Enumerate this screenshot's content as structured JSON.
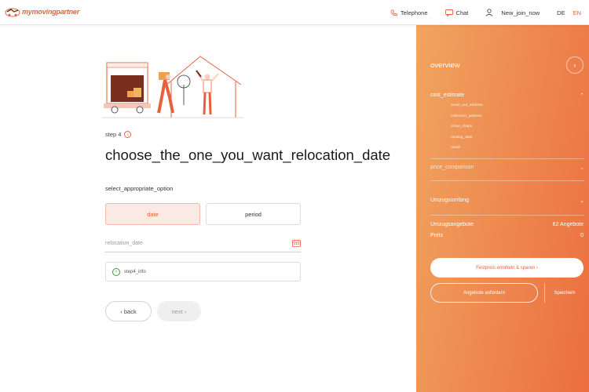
{
  "header": {
    "logo_text": "mymovingpartner",
    "nav": {
      "telephone": "Telephone",
      "chat": "Chat",
      "join": "New_join_now",
      "lang_de": "DE",
      "lang_en": "EN"
    }
  },
  "colors": {
    "accent": "#e8603c",
    "panel_start": "#f0a55f",
    "panel_end": "#ec6e3f"
  },
  "main": {
    "step_label": "step 4",
    "title": "choose_the_one_you_want_relocation_date",
    "subtitle": "select_appropriate_option",
    "options": [
      {
        "label": "date",
        "selected": true
      },
      {
        "label": "period",
        "selected": false
      }
    ],
    "date_placeholder": "relocation_date",
    "info_text": "step4_info",
    "back_label": "‹ back",
    "next_label": "next ›"
  },
  "panel": {
    "overview": "overview",
    "cost_estimate": "cost_estimate",
    "sub_items": [
      "move_out_address",
      "collection_address",
      "move_shape",
      "moving_date",
      "result"
    ],
    "price_comparison": "price_comparison",
    "umzugsumfang": "Umzugsumfang",
    "umzugsangebote_label": "Umzugsangebote",
    "umzugsangebote_value": "62 Angebote",
    "preis_label": "Preis",
    "preis_value": "0",
    "festpreis_button": "Festpreis ermitteln & sparen  ›",
    "angebote_button": "Angebote anfordern",
    "speichern_button": "Speichern"
  }
}
